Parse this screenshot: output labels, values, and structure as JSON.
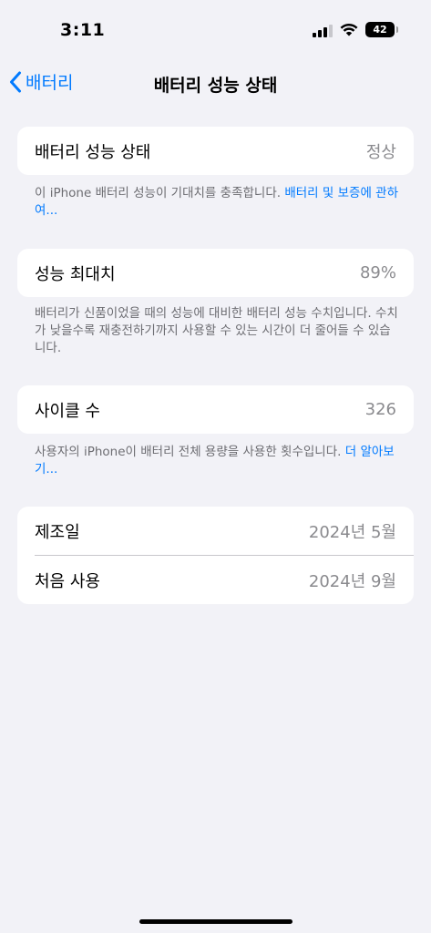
{
  "status_bar": {
    "time": "3:11",
    "battery_level": "42"
  },
  "nav": {
    "back_label": "배터리",
    "title": "배터리 성능 상태"
  },
  "health_section": {
    "label": "배터리 성능 상태",
    "value": "정상",
    "footnote": "이 iPhone 배터리 성능이 기대치를 충족합니다.",
    "footnote_link": "배터리 및 보증에 관하여..."
  },
  "capacity_section": {
    "label": "성능 최대치",
    "value": "89%",
    "footnote": "배터리가 신품이었을 때의 성능에 대비한 배터리 성능 수치입니다. 수치가 낮을수록 재충전하기까지 사용할 수 있는 시간이 더 줄어들 수 있습니다."
  },
  "cycle_section": {
    "label": "사이클 수",
    "value": "326",
    "footnote": "사용자의 iPhone이 배터리 전체 용량을 사용한 횟수입니다.",
    "footnote_link": "더 알아보기..."
  },
  "dates_section": {
    "manufacture_label": "제조일",
    "manufacture_value": "2024년 5월",
    "first_use_label": "처음 사용",
    "first_use_value": "2024년 9월"
  },
  "colors": {
    "accent": "#007aff",
    "background": "#f2f2f7",
    "secondary_text": "#8a8a8e"
  }
}
